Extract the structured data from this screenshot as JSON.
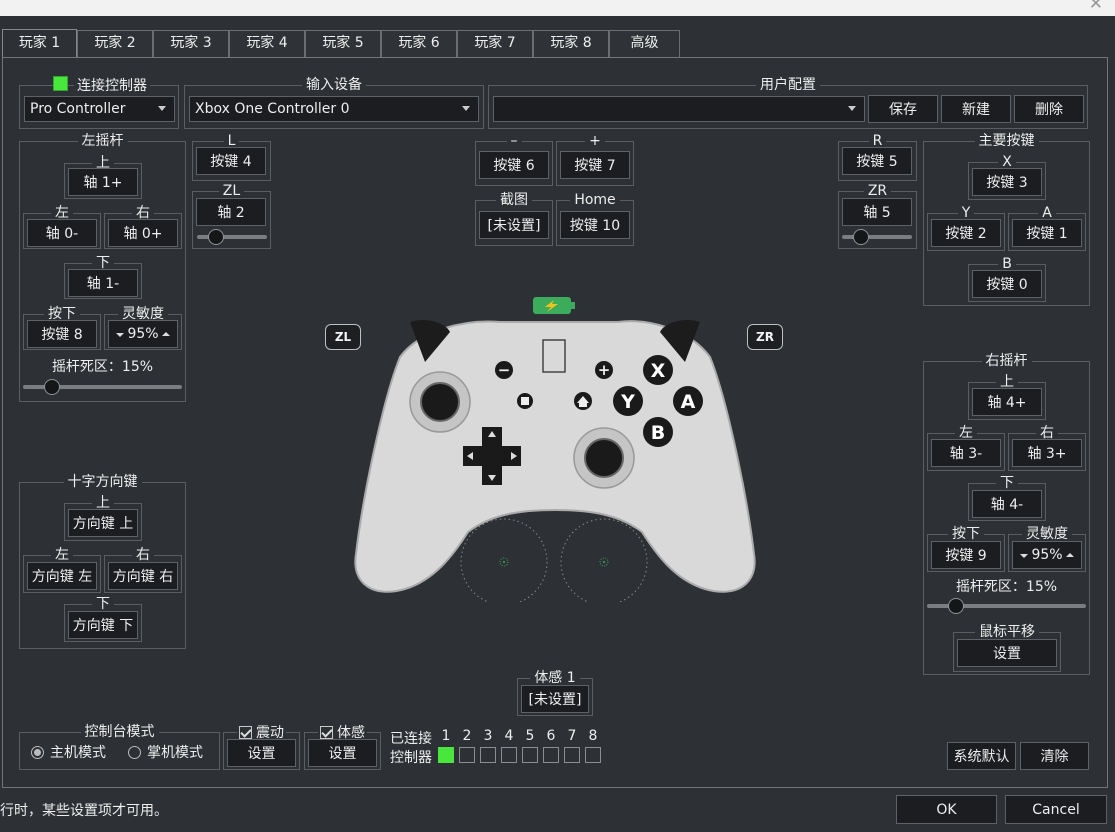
{
  "colors": {
    "background": "#2d3034",
    "connected_indicator": "#49e63d",
    "battery": "#3cab5c",
    "controller_body": "#d9d9d9",
    "controller_face_button": "#1a1a1a"
  },
  "tabs": [
    "玩家 1",
    "玩家 2",
    "玩家 3",
    "玩家 4",
    "玩家 5",
    "玩家 6",
    "玩家 7",
    "玩家 8",
    "高级"
  ],
  "connect": {
    "label": "连接控制器",
    "controller_type": "Pro Controller"
  },
  "input_device": {
    "label": "输入设备",
    "value": "Xbox One Controller 0"
  },
  "profile": {
    "label": "用户配置",
    "value": "",
    "save": "保存",
    "new": "新建",
    "delete": "删除"
  },
  "left_stick": {
    "title": "左摇杆",
    "up_label": "上",
    "up": "轴 1+",
    "left_label": "左",
    "left": "轴 0-",
    "right_label": "右",
    "right": "轴 0+",
    "down_label": "下",
    "down": "轴 1-",
    "press_label": "按下",
    "press": "按键 8",
    "sensitivity_label": "灵敏度",
    "sensitivity": "95%",
    "deadzone": "摇杆死区：15%",
    "deadzone_value": 15
  },
  "l": {
    "label": "L",
    "value": "按键 4"
  },
  "zl": {
    "label": "ZL",
    "value": "轴 2",
    "slider": 20
  },
  "minus": {
    "label": "–",
    "value": "按键 6"
  },
  "plus": {
    "label": "+",
    "value": "按键 7"
  },
  "capture": {
    "label": "截图",
    "value": "[未设置]"
  },
  "home": {
    "label": "Home",
    "value": "按键 10"
  },
  "r": {
    "label": "R",
    "value": "按键 5"
  },
  "zr": {
    "label": "ZR",
    "value": "轴 5",
    "slider": 20
  },
  "face_buttons": {
    "title": "主要按键",
    "x_label": "X",
    "x": "按键 3",
    "y_label": "Y",
    "y": "按键 2",
    "a_label": "A",
    "a": "按键 1",
    "b_label": "B",
    "b": "按键 0"
  },
  "right_stick": {
    "title": "右摇杆",
    "up_label": "上",
    "up": "轴 4+",
    "left_label": "左",
    "left": "轴 3-",
    "right_label": "右",
    "right": "轴 3+",
    "down_label": "下",
    "down": "轴 4-",
    "press_label": "按下",
    "press": "按键 9",
    "sensitivity_label": "灵敏度",
    "sensitivity": "95%",
    "deadzone": "摇杆死区：15%",
    "deadzone_value": 15,
    "mouse_label": "鼠标平移",
    "mouse_button": "设置"
  },
  "dpad": {
    "title": "十字方向键",
    "up_label": "上",
    "up": "方向键 上",
    "left_label": "左",
    "left": "方向键 左",
    "right_label": "右",
    "right": "方向键 右",
    "down_label": "下",
    "down": "方向键 下"
  },
  "controller_image": {
    "zl_tag": "ZL",
    "zr_tag": "ZR",
    "x": "X",
    "y": "Y",
    "a": "A",
    "b": "B",
    "minus": "−",
    "plus": "+"
  },
  "motion": {
    "label": "体感 1",
    "value": "[未设置]"
  },
  "console_mode": {
    "title": "控制台模式",
    "docked": "主机模式",
    "handheld": "掌机模式",
    "selected": "docked"
  },
  "vibration": {
    "label": "震动",
    "button": "设置",
    "checked": true
  },
  "motion_toggle": {
    "label": "体感",
    "button": "设置",
    "checked": true
  },
  "connected": {
    "label_top": "已连接",
    "label_bottom": "控制器",
    "numbers": [
      "1",
      "2",
      "3",
      "4",
      "5",
      "6",
      "7",
      "8"
    ],
    "states": [
      true,
      false,
      false,
      false,
      false,
      false,
      false,
      false
    ]
  },
  "defaults_button": "系统默认",
  "clear_button": "清除",
  "status_text": "行时，某些设置项才可用。",
  "ok": "OK",
  "cancel": "Cancel"
}
